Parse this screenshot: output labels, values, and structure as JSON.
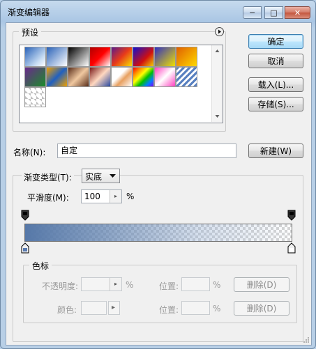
{
  "window": {
    "title": "渐变编辑器",
    "controls": {
      "minimize": "─",
      "maximize": "□",
      "close": "✕"
    }
  },
  "buttons": {
    "ok": "确定",
    "cancel": "取消",
    "load": "载入(L)...",
    "save": "存储(S)...",
    "new": "新建(W)"
  },
  "presets": {
    "title": "预设",
    "menu_icon": "arrow-right-circle-icon",
    "swatches": [
      "linear-gradient(135deg,#2a62b8,#c7dcf3 70%,#ffffff)",
      "linear-gradient(135deg,#2a62b8,rgba(255,255,255,0))",
      "linear-gradient(135deg,#000000,#ffffff)",
      "linear-gradient(135deg,#b00000,#ff0000 50%,#ffffff)",
      "linear-gradient(135deg,#5a1a8c,#e83a1a 50%,#f6e000)",
      "linear-gradient(135deg,#1010d0,#d01010 60%,#f0d000)",
      "linear-gradient(135deg,#3030c0,#f0e000)",
      "linear-gradient(135deg,#e06000,#ffd800)",
      "linear-gradient(135deg,#6a2a8c,#1b8c2a)",
      "linear-gradient(135deg,#f0a000,#2060c0 50%,#f0a000)",
      "linear-gradient(135deg,#5a2e1a,#f0c8a0 50%,#5a2e1a)",
      "linear-gradient(135deg,#7a1a1a,#ffd8c0 50%,#2a4aa0)",
      "linear-gradient(135deg,#ffffff 40%,#e8a060 60%,#ffffff)",
      "linear-gradient(135deg,#ff0000,#ff8800,#ffff00,#00c000,#0080ff,#8000ff)",
      "linear-gradient(135deg,#ff40c0,#ffffff 50%,#ff40c0)",
      "repeating-linear-gradient(135deg,#5880c0 0 3px,#ffffff 3px 6px)",
      "linear-gradient(45deg,#bfbfbf 25%,transparent 25%,transparent 75%,#bfbfbf 75%),linear-gradient(45deg,#bfbfbf 25%,#ffffff 25%,#ffffff 75%,#bfbfbf 75%)"
    ]
  },
  "name_field": {
    "label": "名称(N):",
    "value": "自定"
  },
  "gradient": {
    "type_label": "渐变类型(T):",
    "type_value": "实底",
    "smooth_label": "平滑度(M):",
    "smooth_value": "100",
    "smooth_unit": "%"
  },
  "color_stops": {
    "title": "色标",
    "opacity_label": "不透明度:",
    "opacity_unit": "%",
    "location_label": "位置:",
    "location_unit": "%",
    "delete_label": "删除(D)",
    "color_label": "颜色:"
  },
  "colors": {
    "stop_start": "#5a7bb0",
    "stop_end": "#ffffff"
  }
}
